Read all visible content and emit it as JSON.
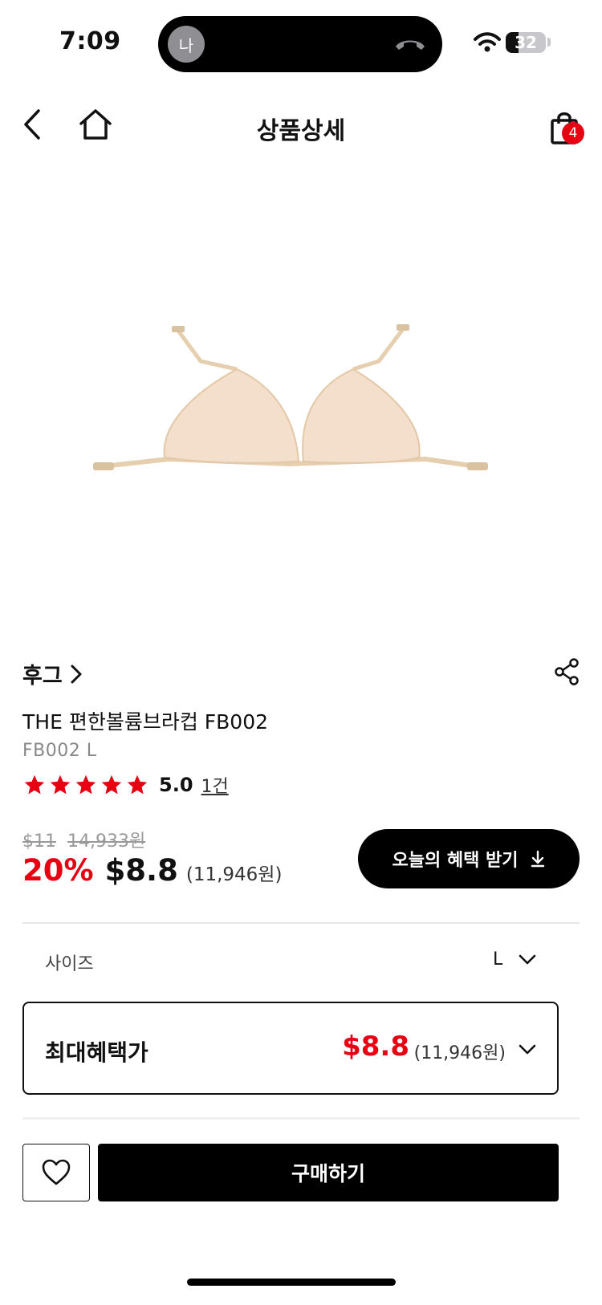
{
  "status_bar": {
    "time": "7:09",
    "call_avatar": "나",
    "battery": "32",
    "battery_level": 0.32
  },
  "header": {
    "title": "상품상세",
    "cart_count": "4",
    "icons": [
      "back-icon",
      "home-icon",
      "cart-icon"
    ]
  },
  "product": {
    "brand": "후그",
    "name": "THE 편한볼륨브라컵 FB002",
    "option": "FB002 L",
    "rating": {
      "score": "5.0",
      "stars": 5,
      "review_count": "1건"
    },
    "price": {
      "original_usd": "$11",
      "original_krw": "14,933원",
      "discount": "20%",
      "sale_usd": "$8.8",
      "sale_krw": "(11,946원)"
    },
    "benefit_button": "오늘의 혜택 받기"
  },
  "size_selector": {
    "label": "사이즈",
    "value": "L"
  },
  "best_benefit": {
    "label": "최대혜택가",
    "price_usd": "$8.8",
    "price_krw": "(11,946원)"
  },
  "actions": {
    "buy_label": "구매하기"
  },
  "colors": {
    "accent_red": "#e60012",
    "black": "#000000"
  }
}
